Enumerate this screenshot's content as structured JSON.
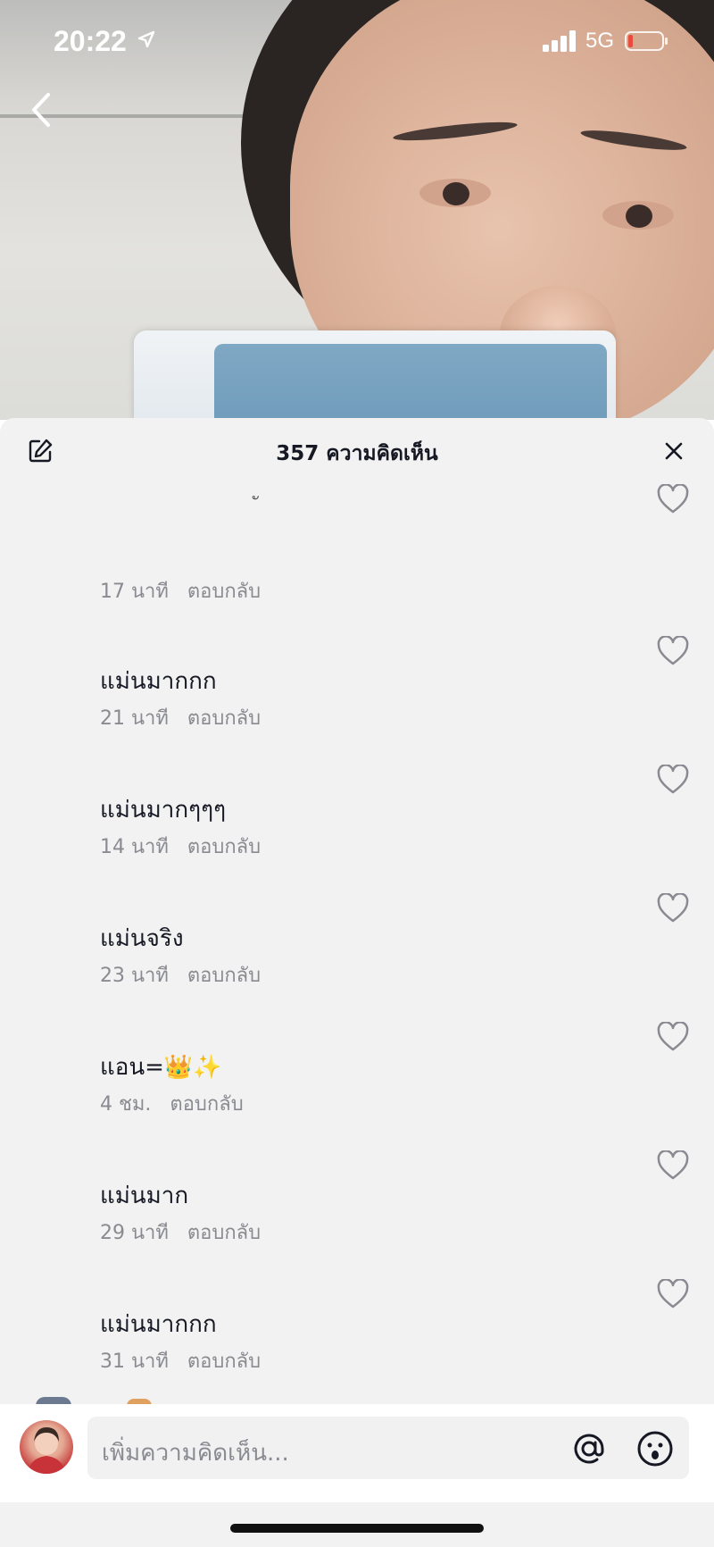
{
  "status_bar": {
    "time": "20:22",
    "network": "5G"
  },
  "header": {
    "title": "357 ความคิดเห็น"
  },
  "comments": [
    {
      "text": "",
      "time": "17 นาที",
      "reply": "ตอบกลับ"
    },
    {
      "text": "แม่นมากกก",
      "time": "21 นาที",
      "reply": "ตอบกลับ"
    },
    {
      "text": "แม่นมากๆๆๆ",
      "time": "14 นาที",
      "reply": "ตอบกลับ"
    },
    {
      "text": "แม่นจริง",
      "time": "23 นาที",
      "reply": "ตอบกลับ"
    },
    {
      "text": "แอน=👑✨",
      "time": "4 ชม.",
      "reply": "ตอบกลับ"
    },
    {
      "text": "แม่นมาก",
      "time": "29 นาที",
      "reply": "ตอบกลับ"
    },
    {
      "text": "แม่นมากกก",
      "time": "31 นาที",
      "reply": "ตอบกลับ"
    }
  ],
  "input": {
    "placeholder": "เพิ่มความคิดเห็น..."
  },
  "icons": {
    "back": "chevron-left-icon",
    "edit": "edit-icon",
    "close": "close-icon",
    "like": "heart-icon",
    "mention": "at-icon",
    "emoji": "emoji-icon"
  },
  "colors": {
    "sheet_bg": "#f2f2f2",
    "text_primary": "#161823",
    "text_secondary": "#8a8b91",
    "battery_low": "#e74c3c"
  }
}
